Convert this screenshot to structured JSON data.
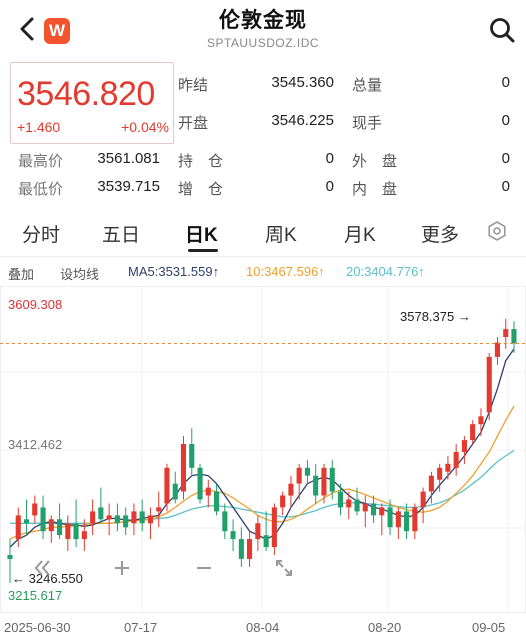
{
  "header": {
    "title": "伦敦金现",
    "code": "SPTAUUSDOZ.IDC",
    "logo": "W"
  },
  "quote": {
    "price": "3546.820",
    "change": "+1.460",
    "change_pct": "+0.04%",
    "fields": [
      {
        "label": "昨结",
        "value": "3545.360"
      },
      {
        "label": "总量",
        "value": "0"
      },
      {
        "label": "开盘",
        "value": "3546.225"
      },
      {
        "label": "现手",
        "value": "0"
      },
      {
        "label": "最高价",
        "value": "3561.081"
      },
      {
        "label": "持　仓",
        "value": "0"
      },
      {
        "label": "外　盘",
        "value": "0"
      },
      {
        "label": "最低价",
        "value": "3539.715"
      },
      {
        "label": "增　仓",
        "value": "0"
      },
      {
        "label": "内　盘",
        "value": "0"
      }
    ]
  },
  "tabs": [
    "分时",
    "五日",
    "日K",
    "周K",
    "月K",
    "更多"
  ],
  "active_tab": "日K",
  "indicators": {
    "overlay": "叠加",
    "setting": "设均线",
    "ma5": "MA5:3531.559↑",
    "ma10": "10:3467.596↑",
    "ma20": "20:3404.776↑"
  },
  "colors": {
    "up": "#e23a2e",
    "down": "#22a06b",
    "ma5": "#2f3f6e",
    "ma10": "#f0a030",
    "ma20": "#5bc0c8"
  },
  "chart_data": {
    "type": "candlestick",
    "y_top_label": "3609.308",
    "y_mid_label": "3412.462",
    "y_bottom_label": "3215.617",
    "max_label": "3578.375",
    "min_label": "3246.550",
    "ref_line": 3546.82,
    "x_labels": [
      "2025-06-30",
      "07-17",
      "08-04",
      "08-20",
      "09-05"
    ],
    "candles": [
      [
        3280,
        3300,
        3245,
        3275
      ],
      [
        3300,
        3340,
        3290,
        3330
      ],
      [
        3325,
        3350,
        3305,
        3320
      ],
      [
        3330,
        3355,
        3320,
        3345
      ],
      [
        3340,
        3355,
        3300,
        3310
      ],
      [
        3310,
        3330,
        3295,
        3325
      ],
      [
        3325,
        3345,
        3300,
        3305
      ],
      [
        3300,
        3330,
        3285,
        3320
      ],
      [
        3320,
        3350,
        3290,
        3300
      ],
      [
        3300,
        3325,
        3285,
        3310
      ],
      [
        3320,
        3350,
        3305,
        3335
      ],
      [
        3340,
        3365,
        3320,
        3325
      ],
      [
        3325,
        3345,
        3305,
        3330
      ],
      [
        3330,
        3345,
        3310,
        3320
      ],
      [
        3330,
        3340,
        3305,
        3315
      ],
      [
        3320,
        3345,
        3305,
        3335
      ],
      [
        3335,
        3350,
        3310,
        3320
      ],
      [
        3320,
        3340,
        3300,
        3330
      ],
      [
        3335,
        3360,
        3315,
        3340
      ],
      [
        3345,
        3395,
        3335,
        3390
      ],
      [
        3370,
        3385,
        3345,
        3350
      ],
      [
        3360,
        3430,
        3350,
        3420
      ],
      [
        3420,
        3440,
        3380,
        3390
      ],
      [
        3390,
        3395,
        3345,
        3350
      ],
      [
        3355,
        3375,
        3340,
        3365
      ],
      [
        3360,
        3370,
        3330,
        3335
      ],
      [
        3335,
        3345,
        3300,
        3310
      ],
      [
        3310,
        3325,
        3285,
        3300
      ],
      [
        3300,
        3315,
        3265,
        3275
      ],
      [
        3275,
        3310,
        3265,
        3300
      ],
      [
        3300,
        3330,
        3285,
        3320
      ],
      [
        3305,
        3335,
        3285,
        3290
      ],
      [
        3290,
        3345,
        3280,
        3340
      ],
      [
        3340,
        3360,
        3330,
        3355
      ],
      [
        3355,
        3380,
        3340,
        3370
      ],
      [
        3370,
        3395,
        3350,
        3390
      ],
      [
        3390,
        3400,
        3370,
        3380
      ],
      [
        3380,
        3395,
        3345,
        3355
      ],
      [
        3355,
        3395,
        3345,
        3390
      ],
      [
        3390,
        3400,
        3350,
        3360
      ],
      [
        3360,
        3370,
        3330,
        3340
      ],
      [
        3340,
        3360,
        3325,
        3350
      ],
      [
        3350,
        3365,
        3330,
        3335
      ],
      [
        3335,
        3355,
        3315,
        3345
      ],
      [
        3345,
        3355,
        3320,
        3330
      ],
      [
        3330,
        3345,
        3305,
        3340
      ],
      [
        3340,
        3350,
        3305,
        3315
      ],
      [
        3315,
        3340,
        3300,
        3335
      ],
      [
        3335,
        3345,
        3300,
        3310
      ],
      [
        3310,
        3345,
        3300,
        3340
      ],
      [
        3340,
        3365,
        3320,
        3360
      ],
      [
        3360,
        3385,
        3345,
        3380
      ],
      [
        3375,
        3395,
        3360,
        3390
      ],
      [
        3385,
        3405,
        3375,
        3395
      ],
      [
        3390,
        3420,
        3380,
        3410
      ],
      [
        3410,
        3430,
        3395,
        3425
      ],
      [
        3425,
        3450,
        3420,
        3445
      ],
      [
        3445,
        3465,
        3430,
        3455
      ],
      [
        3460,
        3535,
        3450,
        3530
      ],
      [
        3530,
        3555,
        3520,
        3548
      ],
      [
        3555,
        3578,
        3540,
        3565
      ],
      [
        3565,
        3575,
        3535,
        3547
      ]
    ],
    "ma5": [
      3290,
      3300,
      3305,
      3315,
      3320,
      3322,
      3320,
      3318,
      3318,
      3316,
      3318,
      3322,
      3326,
      3326,
      3324,
      3324,
      3326,
      3328,
      3330,
      3345,
      3355,
      3370,
      3380,
      3382,
      3380,
      3370,
      3355,
      3340,
      3325,
      3310,
      3305,
      3300,
      3305,
      3320,
      3340,
      3355,
      3370,
      3375,
      3378,
      3375,
      3365,
      3355,
      3348,
      3345,
      3340,
      3338,
      3334,
      3330,
      3328,
      3330,
      3340,
      3355,
      3368,
      3380,
      3392,
      3405,
      3420,
      3435,
      3460,
      3490,
      3525,
      3540
    ],
    "ma10": [
      3300,
      3305,
      3308,
      3310,
      3312,
      3315,
      3315,
      3316,
      3317,
      3318,
      3320,
      3320,
      3320,
      3321,
      3322,
      3323,
      3324,
      3325,
      3328,
      3333,
      3340,
      3348,
      3355,
      3360,
      3362,
      3360,
      3358,
      3352,
      3345,
      3338,
      3330,
      3325,
      3322,
      3322,
      3325,
      3330,
      3338,
      3345,
      3352,
      3358,
      3362,
      3363,
      3360,
      3356,
      3352,
      3348,
      3344,
      3340,
      3337,
      3335,
      3334,
      3336,
      3340,
      3348,
      3358,
      3368,
      3380,
      3395,
      3410,
      3430,
      3450,
      3468
    ],
    "ma20": [
      3320,
      3320,
      3320,
      3320,
      3320,
      3320,
      3320,
      3320,
      3320,
      3320,
      3320,
      3320,
      3320,
      3321,
      3322,
      3323,
      3324,
      3325,
      3326,
      3327,
      3330,
      3334,
      3338,
      3340,
      3342,
      3342,
      3341,
      3340,
      3338,
      3336,
      3334,
      3332,
      3330,
      3328,
      3328,
      3330,
      3333,
      3336,
      3340,
      3343,
      3345,
      3346,
      3346,
      3345,
      3344,
      3343,
      3342,
      3341,
      3340,
      3340,
      3341,
      3343,
      3346,
      3350,
      3356,
      3362,
      3370,
      3378,
      3388,
      3398,
      3405,
      3412
    ]
  }
}
